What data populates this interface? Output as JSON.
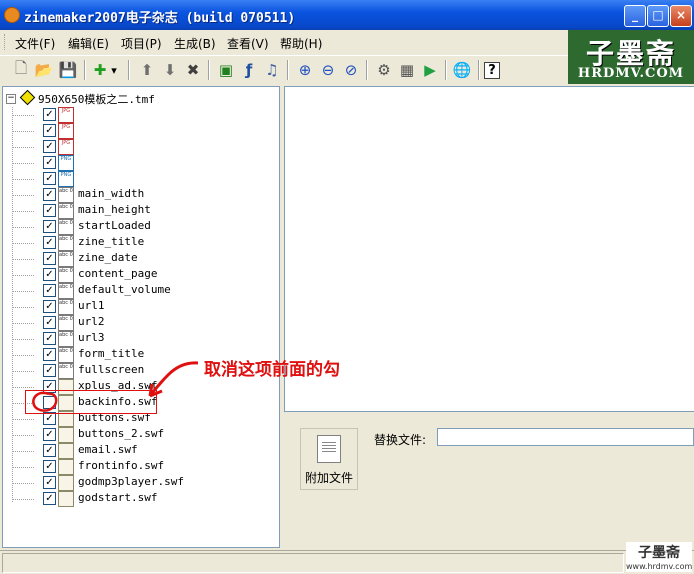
{
  "window": {
    "title": "zinemaker2007电子杂志 (build 070511)",
    "controls": {
      "minimize": "_",
      "maximize": "□",
      "close": "×"
    },
    "accent": "#0a54e0"
  },
  "menu": [
    "文件(F)",
    "编辑(E)",
    "项目(P)",
    "生成(B)",
    "查看(V)",
    "帮助(H)"
  ],
  "toolbar": {
    "icons": [
      {
        "name": "new-icon",
        "glyph": "🗋"
      },
      {
        "name": "open-icon",
        "glyph": "📂"
      },
      {
        "name": "save-icon",
        "glyph": "💾"
      },
      {
        "name": "add-icon",
        "glyph": "✚"
      },
      {
        "name": "dropdown-icon",
        "glyph": "▾"
      },
      {
        "name": "move-up-icon",
        "glyph": "⬆"
      },
      {
        "name": "move-down-icon",
        "glyph": "⬇"
      },
      {
        "name": "delete-icon",
        "glyph": "✖"
      },
      {
        "name": "image-icon",
        "glyph": "▣"
      },
      {
        "name": "flash-icon",
        "glyph": "ƒ"
      },
      {
        "name": "music-icon",
        "glyph": "♫"
      },
      {
        "name": "zoom-in-icon",
        "glyph": "⊕"
      },
      {
        "name": "zoom-out-icon",
        "glyph": "⊖"
      },
      {
        "name": "zoom-fit-icon",
        "glyph": "⊘"
      },
      {
        "name": "build-icon",
        "glyph": "⚙"
      },
      {
        "name": "exe-icon",
        "glyph": "▦"
      },
      {
        "name": "play-icon",
        "glyph": "▶"
      },
      {
        "name": "web-icon",
        "glyph": "🌐"
      },
      {
        "name": "help-icon",
        "glyph": "?"
      }
    ]
  },
  "logo": {
    "big": "子墨斋",
    "small": "HRDMV.COM"
  },
  "tree": {
    "root": "950X650模板之二.tmf",
    "items": [
      {
        "label": "",
        "type": "jpg",
        "type_label": "JPG",
        "checked": true
      },
      {
        "label": "",
        "type": "jpg",
        "type_label": "JPG",
        "checked": true
      },
      {
        "label": "",
        "type": "jpg",
        "type_label": "JPG",
        "checked": true
      },
      {
        "label": "",
        "type": "png",
        "type_label": "PNG",
        "checked": true
      },
      {
        "label": "",
        "type": "png",
        "type_label": "PNG",
        "checked": true
      },
      {
        "label": "main_width",
        "type": "var",
        "type_label": "abc 010",
        "checked": true
      },
      {
        "label": "main_height",
        "type": "var",
        "type_label": "abc 010",
        "checked": true
      },
      {
        "label": "startLoaded",
        "type": "var",
        "type_label": "abc 010",
        "checked": true
      },
      {
        "label": "zine_title",
        "type": "var",
        "type_label": "abc 010",
        "checked": true
      },
      {
        "label": "zine_date",
        "type": "var",
        "type_label": "abc 010",
        "checked": true
      },
      {
        "label": "content_page",
        "type": "var",
        "type_label": "abc 010",
        "checked": true
      },
      {
        "label": "default_volume",
        "type": "var",
        "type_label": "abc 010",
        "checked": true
      },
      {
        "label": "url1",
        "type": "var",
        "type_label": "abc 010",
        "checked": true
      },
      {
        "label": "url2",
        "type": "var",
        "type_label": "abc 010",
        "checked": true
      },
      {
        "label": "url3",
        "type": "var",
        "type_label": "abc 010",
        "checked": true
      },
      {
        "label": "form_title",
        "type": "var",
        "type_label": "abc 010",
        "checked": true
      },
      {
        "label": "fullscreen",
        "type": "var",
        "type_label": "abc 010",
        "checked": true
      },
      {
        "label": "xplus_ad.swf",
        "type": "swf",
        "type_label": "",
        "checked": true
      },
      {
        "label": "backinfo.swf",
        "type": "swf",
        "type_label": "",
        "checked": false
      },
      {
        "label": "buttons.swf",
        "type": "swf",
        "type_label": "",
        "checked": true
      },
      {
        "label": "buttons_2.swf",
        "type": "swf",
        "type_label": "",
        "checked": true
      },
      {
        "label": "email.swf",
        "type": "swf",
        "type_label": "",
        "checked": true
      },
      {
        "label": "frontinfo.swf",
        "type": "swf",
        "type_label": "",
        "checked": true
      },
      {
        "label": "godmp3player.swf",
        "type": "swf",
        "type_label": "",
        "checked": true
      },
      {
        "label": "godstart.swf",
        "type": "swf",
        "type_label": "",
        "checked": true
      }
    ]
  },
  "bottom": {
    "attach_label": "附加文件",
    "replace_label": "替换文件:",
    "replace_value": ""
  },
  "annotation": {
    "text": "取消这项前面的勾",
    "color": "#e01010"
  },
  "watermark": {
    "line1": "子墨斋",
    "line2": "www.hrdmv.com"
  }
}
